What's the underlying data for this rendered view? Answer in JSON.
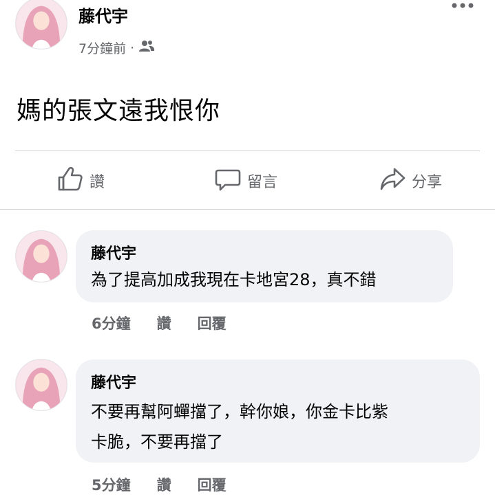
{
  "post": {
    "author": "藤代宇",
    "time": "7分鐘前",
    "separator": "·",
    "audience_icon": "friends-icon",
    "text": "媽的張文遠我恨你"
  },
  "actions": {
    "like_label": "讚",
    "comment_label": "留言",
    "share_label": "分享"
  },
  "comments": [
    {
      "author": "藤代宇",
      "text": "為了提高加成我現在卡地宮28，真不錯",
      "time": "6分鐘",
      "like_label": "讚",
      "reply_label": "回覆"
    },
    {
      "author": "藤代宇",
      "text_line1": "不要再幫阿蟬擋了，幹你娘，你金卡比紫",
      "text_line2": "卡脆，不要再擋了",
      "time": "5分鐘",
      "like_label": "讚",
      "reply_label": "回覆"
    }
  ],
  "colors": {
    "secondary_text": "#65676b",
    "bubble_bg": "#f0f2f5",
    "divider": "#ced0d4"
  }
}
